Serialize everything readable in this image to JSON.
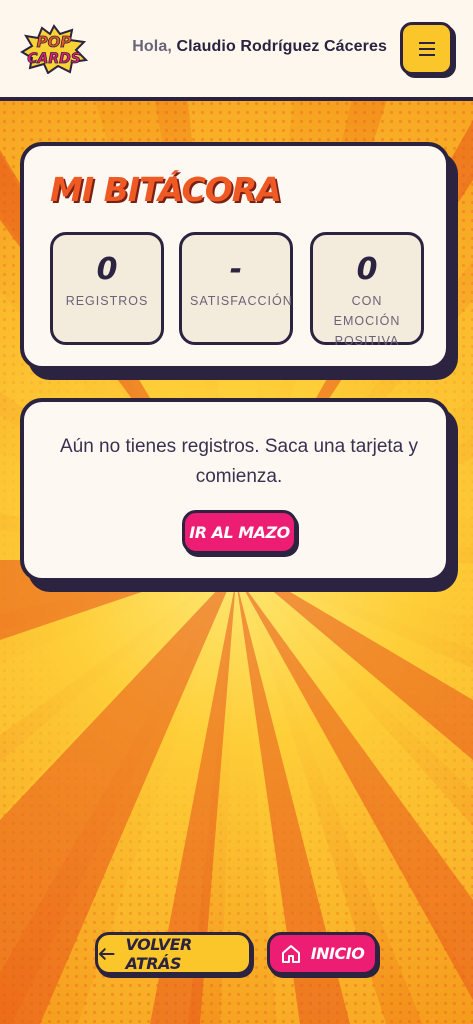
{
  "app": {
    "logo_line1": "POP",
    "logo_line2": "CARDS"
  },
  "header": {
    "greeting": "Hola,",
    "user_name": "Claudio Rodríguez Cáceres",
    "menu_icon": "hamburger-menu-icon"
  },
  "journal": {
    "title": "MI BITÁCORA",
    "stats": [
      {
        "value": "0",
        "label": "REGISTROS"
      },
      {
        "value": "-",
        "label": "SATISFACCIÓN"
      },
      {
        "value": "0",
        "label": "CON EMOCIÓN POSITIVA"
      }
    ]
  },
  "empty_state": {
    "message": "Aún no tienes registros. Saca una tarjeta y comienza.",
    "button_label": "IR AL MAZO"
  },
  "nav": {
    "back_label": "VOLVER ATRÁS",
    "back_icon": "arrow-left-icon",
    "home_label": "INICIO",
    "home_icon": "home-icon"
  },
  "colors": {
    "accent_orange": "#ef5a24",
    "accent_yellow": "#fbc62a",
    "accent_pink": "#ec1d73",
    "ink": "#2b2340",
    "card_bg": "#fdf9f2"
  }
}
